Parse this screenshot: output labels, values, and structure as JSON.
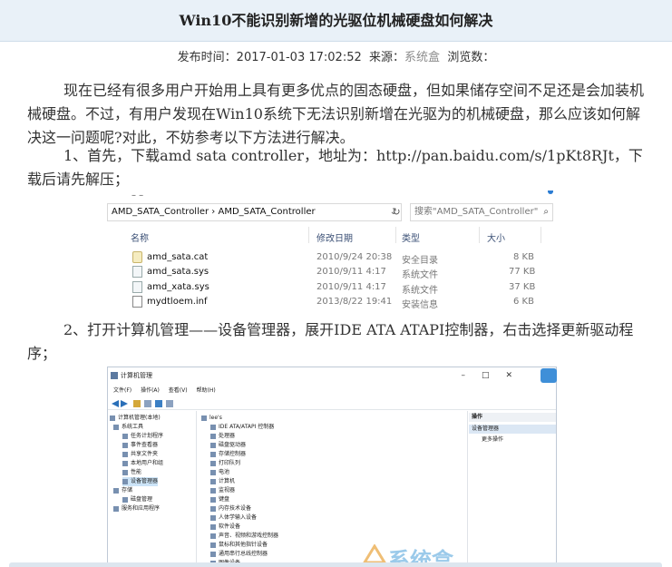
{
  "article": {
    "title": "Win10不能识别新增的光驱位机械硬盘如何解决",
    "meta": {
      "publish_label": "发布时间：",
      "publish_time": "2017-01-03 17:02:52",
      "source_label": "来源：",
      "source": "系统盒",
      "views_label": "浏览数："
    },
    "paragraphs": [
      "现在已经有很多用户开始用上具有更多优点的固态硬盘，但如果储存空间不足还是会加装机械硬盘。不过，有用户发现在Win10系统下无法识别新增在光驱为的机械硬盘，那么应该如何解决这一问题呢?对此，不妨参考以下方法进行解决。",
      "1、首先，下载amd sata controller，地址为：http://pan.baidu.com/s/1pKt8RJt，下载后请先解压；",
      "2、打开计算机管理——设备管理器，展开IDE ATA ATAPI控制器，右击选择更新驱动程序；"
    ]
  },
  "explorer": {
    "top_fragment": "– –",
    "address": "AMD_SATA_Controller  ›  AMD_SATA_Controller",
    "search_placeholder": "搜索\"AMD_SATA_Controller\"",
    "columns": [
      "名称",
      "修改日期",
      "类型",
      "大小"
    ],
    "files": [
      {
        "name": "amd_sata.cat",
        "date": "2010/9/24 20:38",
        "type": "安全目录",
        "size": "8 KB",
        "icon": "catalog-file-icon"
      },
      {
        "name": "amd_sata.sys",
        "date": "2010/9/11 4:17",
        "type": "系统文件",
        "size": "77 KB",
        "icon": "system-file-icon"
      },
      {
        "name": "amd_xata.sys",
        "date": "2010/9/11 4:17",
        "type": "系统文件",
        "size": "37 KB",
        "icon": "system-file-icon"
      },
      {
        "name": "mydtloem.inf",
        "date": "2013/8/22 19:41",
        "type": "安装信息",
        "size": "6 KB",
        "icon": "setup-info-icon"
      }
    ]
  },
  "computer_management": {
    "window_title": "计算机管理",
    "menu": [
      "文件(F)",
      "操作(A)",
      "查看(V)",
      "帮助(H)"
    ],
    "left_tree": [
      "计算机管理(本地)",
      "系统工具",
      "任务计划程序",
      "事件查看器",
      "共享文件夹",
      "本地用户和组",
      "性能",
      "设备管理器",
      "存储",
      "磁盘管理",
      "服务和应用程序"
    ],
    "device_root": "lee's",
    "devices": [
      "IDE ATA/ATAPI 控制器",
      "处理器",
      "磁盘驱动器",
      "存储控制器",
      "打印队列",
      "电池",
      "计算机",
      "监视器",
      "键盘",
      "内存技术设备",
      "人体学输入设备",
      "软件设备",
      "声音、视频和游戏控制器",
      "鼠标和其他指针设备",
      "通用串行总线控制器",
      "图像设备"
    ],
    "actions_header": "操作",
    "actions_selected": "设备管理器",
    "actions_more": "更多操作"
  },
  "watermark": "系统盒"
}
